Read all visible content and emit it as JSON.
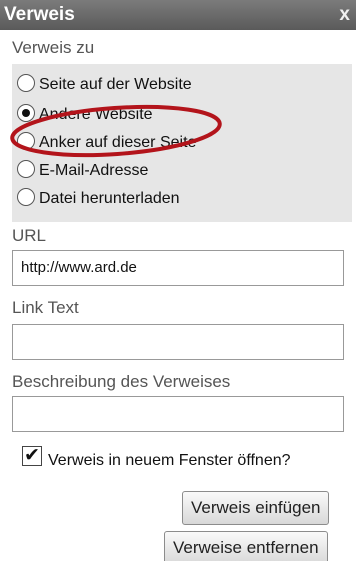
{
  "dialog": {
    "title": "Verweis",
    "close_glyph": "x"
  },
  "link_to": {
    "label": "Verweis zu",
    "options": [
      {
        "label": "Seite auf der Website",
        "checked": false
      },
      {
        "label": "Andere Website",
        "checked": true
      },
      {
        "label": "Anker auf dieser Seite",
        "checked": false
      },
      {
        "label": "E-Mail-Adresse",
        "checked": false
      },
      {
        "label": "Datei herunterladen",
        "checked": false
      }
    ]
  },
  "url": {
    "label": "URL",
    "value": "http://www.ard.de"
  },
  "link_text": {
    "label": "Link Text",
    "value": ""
  },
  "description": {
    "label": "Beschreibung des Verweises",
    "value": ""
  },
  "new_window": {
    "label": "Verweis in neuem Fenster öffnen?",
    "checked": true,
    "mark": "✔"
  },
  "buttons": {
    "insert": "Verweis einfügen",
    "remove": "Verweise entfernen"
  },
  "colors": {
    "highlight": "#b3141b",
    "titlebar": "#6a6a6a",
    "radio_group_bg": "#e6e6e6"
  }
}
